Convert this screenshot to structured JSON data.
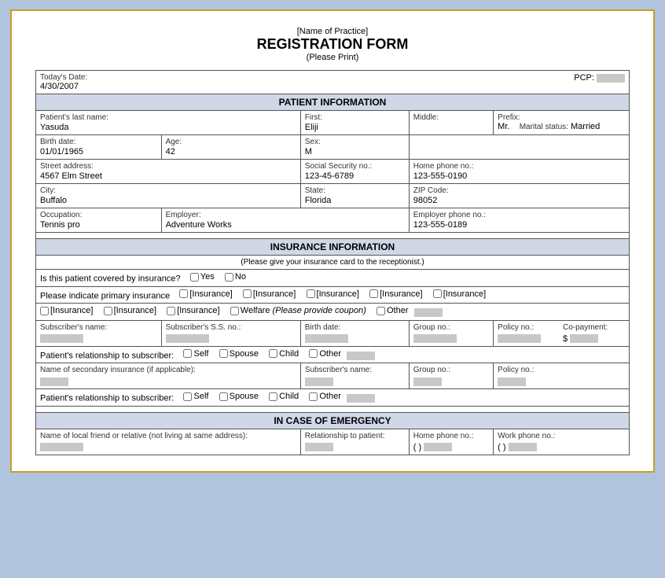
{
  "header": {
    "practice_name": "[Name of Practice]",
    "form_title": "REGISTRATION FORM",
    "print_note": "(Please Print)"
  },
  "top": {
    "date_label": "Today's Date:",
    "date_value": "4/30/2007",
    "pcp_label": "PCP:",
    "pcp_value": ""
  },
  "patient_info": {
    "section_title": "PATIENT INFORMATION",
    "last_name_label": "Patient's last name:",
    "last_name_value": "Yasuda",
    "first_label": "First:",
    "first_value": "Eliji",
    "middle_label": "Middle:",
    "middle_value": "",
    "prefix_label": "Prefix:",
    "prefix_value": "Mr.",
    "marital_label": "Marital status:",
    "marital_value": "Married",
    "birth_label": "Birth date:",
    "birth_value": "01/01/1965",
    "age_label": "Age:",
    "age_value": "42",
    "sex_label": "Sex:",
    "sex_value": "M",
    "street_label": "Street address:",
    "street_value": "4567 Elm Street",
    "ssn_label": "Social Security no.:",
    "ssn_value": "123-45-6789",
    "home_phone_label": "Home phone no.:",
    "home_phone_value": "123-555-0190",
    "city_label": "City:",
    "city_value": "Buffalo",
    "state_label": "State:",
    "state_value": "Florida",
    "zip_label": "ZIP Code:",
    "zip_value": "98052",
    "occupation_label": "Occupation:",
    "occupation_value": "Tennis pro",
    "employer_label": "Employer:",
    "employer_value": "Adventure Works",
    "employer_phone_label": "Employer phone no.:",
    "employer_phone_value": "123-555-0189"
  },
  "insurance_info": {
    "section_title": "INSURANCE INFORMATION",
    "section_sub": "(Please give your insurance card to the receptionist.)",
    "covered_label": "Is this patient covered by insurance?",
    "yes_label": "Yes",
    "no_label": "No",
    "primary_label": "Please indicate primary insurance",
    "insurance_options": [
      "[Insurance]",
      "[Insurance]",
      "[Insurance]",
      "[Insurance]",
      "[Insurance]",
      "[Insurance]",
      "[Insurance]",
      "[Insurance]"
    ],
    "welfare_label": "Welfare",
    "welfare_note": "(Please provide coupon)",
    "other_label": "Other",
    "subscriber_name_label": "Subscriber's name:",
    "subscriber_ss_label": "Subscriber's S.S. no.:",
    "birth_date_label": "Birth date:",
    "group_no_label": "Group no.:",
    "policy_no_label": "Policy no.:",
    "copay_label": "Co-payment:",
    "copay_prefix": "$",
    "relationship_label": "Patient's relationship to subscriber:",
    "self_label": "Self",
    "spouse_label": "Spouse",
    "child_label": "Child",
    "other2_label": "Other",
    "secondary_label": "Name of secondary insurance (if applicable):",
    "sub_name2_label": "Subscriber's name:",
    "group_no2_label": "Group no.:",
    "policy_no2_label": "Policy no.:",
    "relationship2_label": "Patient's relationship to subscriber:",
    "self2_label": "Self",
    "spouse2_label": "Spouse",
    "child2_label": "Child",
    "other3_label": "Other"
  },
  "emergency": {
    "section_title": "IN CASE OF EMERGENCY",
    "name_label": "Name of local friend or relative (not living at same address):",
    "relationship_label": "Relationship to patient:",
    "home_phone_label": "Home phone no.:",
    "home_phone_format": "( )",
    "work_phone_label": "Work phone no.:",
    "work_phone_format": "( )"
  }
}
